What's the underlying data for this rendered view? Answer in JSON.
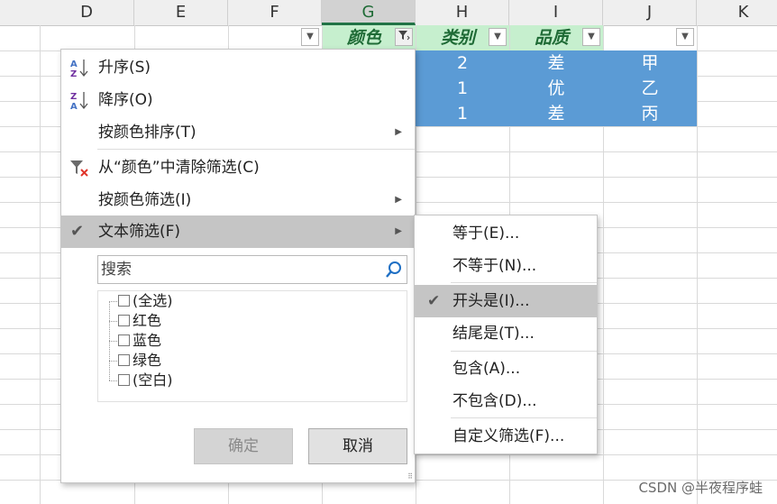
{
  "columns": [
    "D",
    "E",
    "F",
    "G",
    "H",
    "I",
    "J",
    "K"
  ],
  "selected_column": "G",
  "header_row": {
    "color": "颜色",
    "category": "类别",
    "quality": "品质"
  },
  "rows": [
    {
      "h": "2",
      "i": "差",
      "j": "甲"
    },
    {
      "h": "1",
      "i": "优",
      "j": "乙"
    },
    {
      "h": "1",
      "i": "差",
      "j": "丙"
    }
  ],
  "menu": {
    "sort_asc": "升序(S)",
    "sort_desc": "降序(O)",
    "sort_by_color": "按颜色排序(T)",
    "clear_filter": "从“颜色”中清除筛选(C)",
    "filter_by_color": "按颜色筛选(I)",
    "text_filter": "文本筛选(F)",
    "search_placeholder": "搜索",
    "list": [
      "(全选)",
      "红色",
      "蓝色",
      "绿色",
      "(空白)"
    ],
    "ok": "确定",
    "cancel": "取消"
  },
  "submenu": {
    "equals": "等于(E)...",
    "not_equals": "不等于(N)...",
    "begins_with": "开头是(I)...",
    "ends_with": "结尾是(T)...",
    "contains": "包含(A)...",
    "not_contains": "不包含(D)...",
    "custom": "自定义筛选(F)..."
  },
  "watermark": "CSDN @半夜程序蛙",
  "colors": {
    "accent_green": "#217346",
    "header_green": "#c6efce",
    "selection_blue": "#5b9bd5",
    "highlight": "#c5c5c5"
  }
}
